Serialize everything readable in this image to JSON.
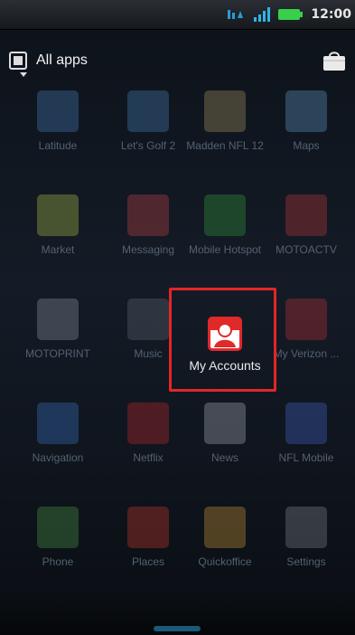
{
  "status_bar": {
    "time": "12:00"
  },
  "header": {
    "title": "All apps"
  },
  "apps": [
    {
      "label": "Latitude",
      "icon": "latitude-icon",
      "color": "#4a88c7"
    },
    {
      "label": "Let's Golf 2",
      "icon": "golf-icon",
      "color": "#4f8cc8"
    },
    {
      "label": "Madden NFL 12",
      "icon": "madden-icon",
      "color": "#b8a36b"
    },
    {
      "label": "Maps",
      "icon": "maps-icon",
      "color": "#6aa8d8"
    },
    {
      "label": "Market",
      "icon": "market-icon",
      "color": "#b9d24c"
    },
    {
      "label": "Messaging",
      "icon": "messaging-icon",
      "color": "#cf4a4a"
    },
    {
      "label": "Mobile Hotspot",
      "icon": "hotspot-icon",
      "color": "#38a73d"
    },
    {
      "label": "MOTOACTV",
      "icon": "motoactv-icon",
      "color": "#d03a3a"
    },
    {
      "label": "MOTOPRINT",
      "icon": "motoprint-icon",
      "color": "#9aa3ad"
    },
    {
      "label": "Music",
      "icon": "music-icon",
      "color": "#6a6f78"
    },
    {
      "label": "My Accounts",
      "icon": "my-accounts-icon",
      "color": "#e02a2a"
    },
    {
      "label": "My Verizon ...",
      "icon": "my-verizon-icon",
      "color": "#d0353a"
    },
    {
      "label": "Navigation",
      "icon": "navigation-icon",
      "color": "#3d7fd8"
    },
    {
      "label": "Netflix",
      "icon": "netflix-icon",
      "color": "#d32a2a"
    },
    {
      "label": "News",
      "icon": "news-icon",
      "color": "#b9bec6"
    },
    {
      "label": "NFL Mobile",
      "icon": "nfl-icon",
      "color": "#4a6ed8"
    },
    {
      "label": "Phone",
      "icon": "phone-icon",
      "color": "#53a54c"
    },
    {
      "label": "Places",
      "icon": "places-icon",
      "color": "#de3b2e"
    },
    {
      "label": "Quickoffice",
      "icon": "quickoffice-icon",
      "color": "#e2a43a"
    },
    {
      "label": "Settings",
      "icon": "settings-icon",
      "color": "#8d939c"
    }
  ]
}
